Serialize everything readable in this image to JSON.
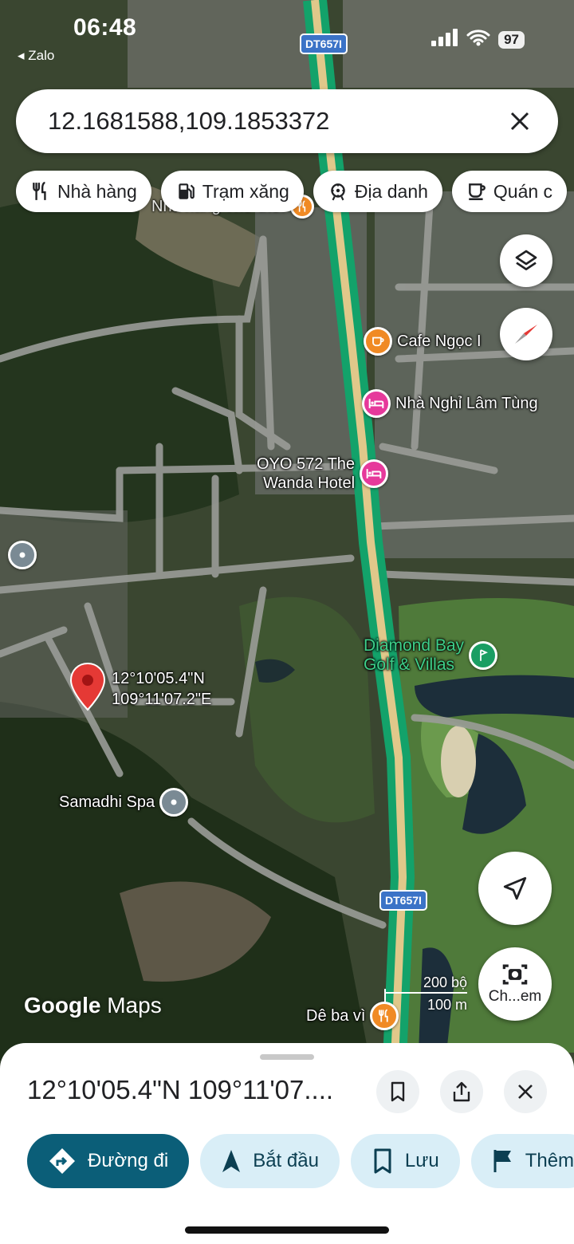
{
  "status_bar": {
    "time": "06:48",
    "back_app": "◂ Zalo",
    "battery": "97"
  },
  "search": {
    "query": "12.1681588,109.1853372"
  },
  "chips": [
    {
      "label": "Nhà hàng",
      "icon": "restaurant-icon"
    },
    {
      "label": "Trạm xăng",
      "icon": "gas-station-icon"
    },
    {
      "label": "Địa danh",
      "icon": "landmark-icon"
    },
    {
      "label": "Quán c",
      "icon": "coffee-icon"
    }
  ],
  "map": {
    "road_shield_top": "DT657I",
    "road_shield_bottom": "DT657I",
    "pois": {
      "cafe": "Cafe Ngọc I",
      "motel": "Nhà Nghỉ Lâm Tùng",
      "hotel": "OYO 572 The\nWanda Hotel",
      "golf": "Diamond Bay\nGolf & Villas",
      "spa": "Samadhi Spa",
      "restaurant_bottom": "Dê ba vì",
      "restaurant_top": "Nhà hàng Thơ thơi"
    },
    "pin_coords": {
      "lat": "12°10'05.4\"N",
      "lng": "109°11'07.2\"E"
    },
    "logo": {
      "google": "Google",
      "maps": "Maps"
    },
    "scale": {
      "imperial": "200 bộ",
      "metric": "100 m"
    },
    "camera_fab_label": "Ch...em"
  },
  "sheet": {
    "title": "12°10'05.4\"N 109°11'07....",
    "actions": [
      {
        "label": "Đường đi",
        "icon": "directions-icon"
      },
      {
        "label": "Bắt đầu",
        "icon": "navigation-arrow-icon"
      },
      {
        "label": "Lưu",
        "icon": "bookmark-icon"
      },
      {
        "label": "Thêm",
        "icon": "flag-icon"
      }
    ]
  },
  "colors": {
    "primary": "#0b5e78",
    "secondary": "#d9eef7",
    "road": "#1fc77a",
    "pin": "#e53935"
  }
}
